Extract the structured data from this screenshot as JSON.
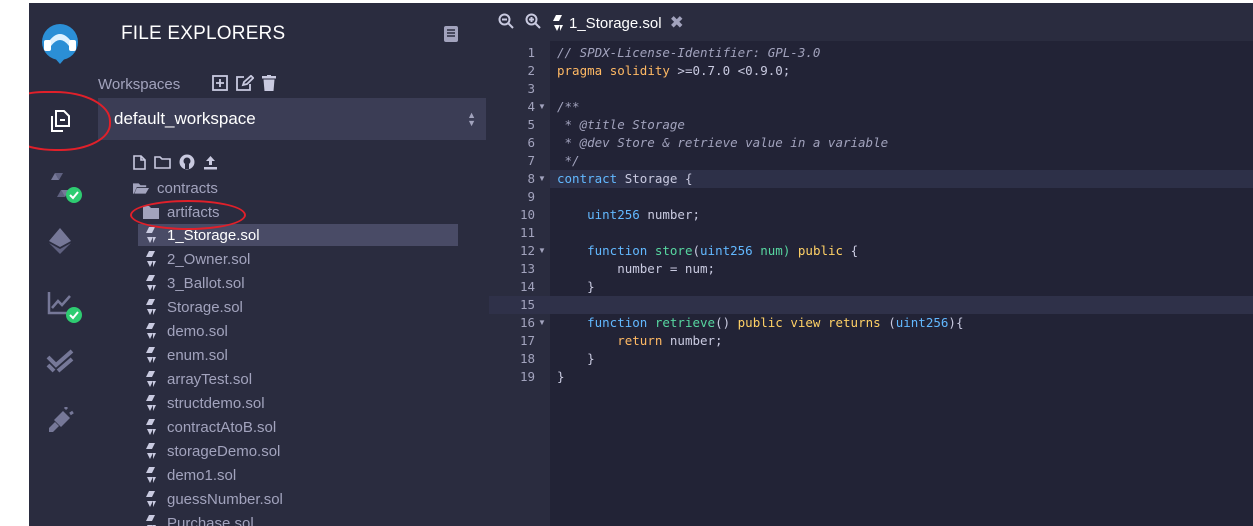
{
  "colors": {
    "accent": "#2ecc71",
    "annotation": "#e0202a"
  },
  "rail": {
    "items": [
      {
        "name": "logo-icon"
      },
      {
        "name": "file-explorers-icon",
        "selected": true
      },
      {
        "name": "solidity-compiler-icon",
        "badge": "check"
      },
      {
        "name": "deploy-run-icon"
      },
      {
        "name": "analysis-icon",
        "badge": "check"
      },
      {
        "name": "testing-icon"
      },
      {
        "name": "plugin-manager-icon"
      }
    ]
  },
  "panel": {
    "title": "FILE EXPLORERS",
    "workspaces_label": "Workspaces",
    "workspace_selected": "default_workspace"
  },
  "tree": {
    "folders": [
      {
        "label": "contracts"
      },
      {
        "label": "artifacts"
      }
    ],
    "files": [
      {
        "label": "1_Storage.sol",
        "selected": true
      },
      {
        "label": "2_Owner.sol"
      },
      {
        "label": "3_Ballot.sol"
      },
      {
        "label": "Storage.sol"
      },
      {
        "label": "demo.sol"
      },
      {
        "label": "enum.sol"
      },
      {
        "label": "arrayTest.sol"
      },
      {
        "label": "structdemo.sol"
      },
      {
        "label": "contractAtoB.sol"
      },
      {
        "label": "storageDemo.sol"
      },
      {
        "label": "demo1.sol"
      },
      {
        "label": "guessNumber.sol"
      },
      {
        "label": "Purchase.sol"
      }
    ]
  },
  "editor": {
    "tab_label": "1_Storage.sol",
    "lines": [
      {
        "n": "1",
        "text": "// SPDX-License-Identifier: GPL-3.0"
      },
      {
        "n": "2",
        "text": "pragma solidity >=0.7.0 <0.9.0;"
      },
      {
        "n": "3",
        "text": ""
      },
      {
        "n": "4",
        "text": "/**",
        "fold": true
      },
      {
        "n": "5",
        "text": " * @title Storage"
      },
      {
        "n": "6",
        "text": " * @dev Store & retrieve value in a variable"
      },
      {
        "n": "7",
        "text": " */"
      },
      {
        "n": "8",
        "text": "contract Storage {",
        "fold": true
      },
      {
        "n": "9",
        "text": ""
      },
      {
        "n": "10",
        "text": "    uint256 number;"
      },
      {
        "n": "11",
        "text": ""
      },
      {
        "n": "12",
        "text": "    function store(uint256 num) public {",
        "fold": true
      },
      {
        "n": "13",
        "text": "        number = num;"
      },
      {
        "n": "14",
        "text": "    }"
      },
      {
        "n": "15",
        "text": ""
      },
      {
        "n": "16",
        "text": "    function retrieve() public view returns (uint256){",
        "fold": true
      },
      {
        "n": "17",
        "text": "        return number;"
      },
      {
        "n": "18",
        "text": "    }"
      },
      {
        "n": "19",
        "text": "}"
      }
    ]
  }
}
